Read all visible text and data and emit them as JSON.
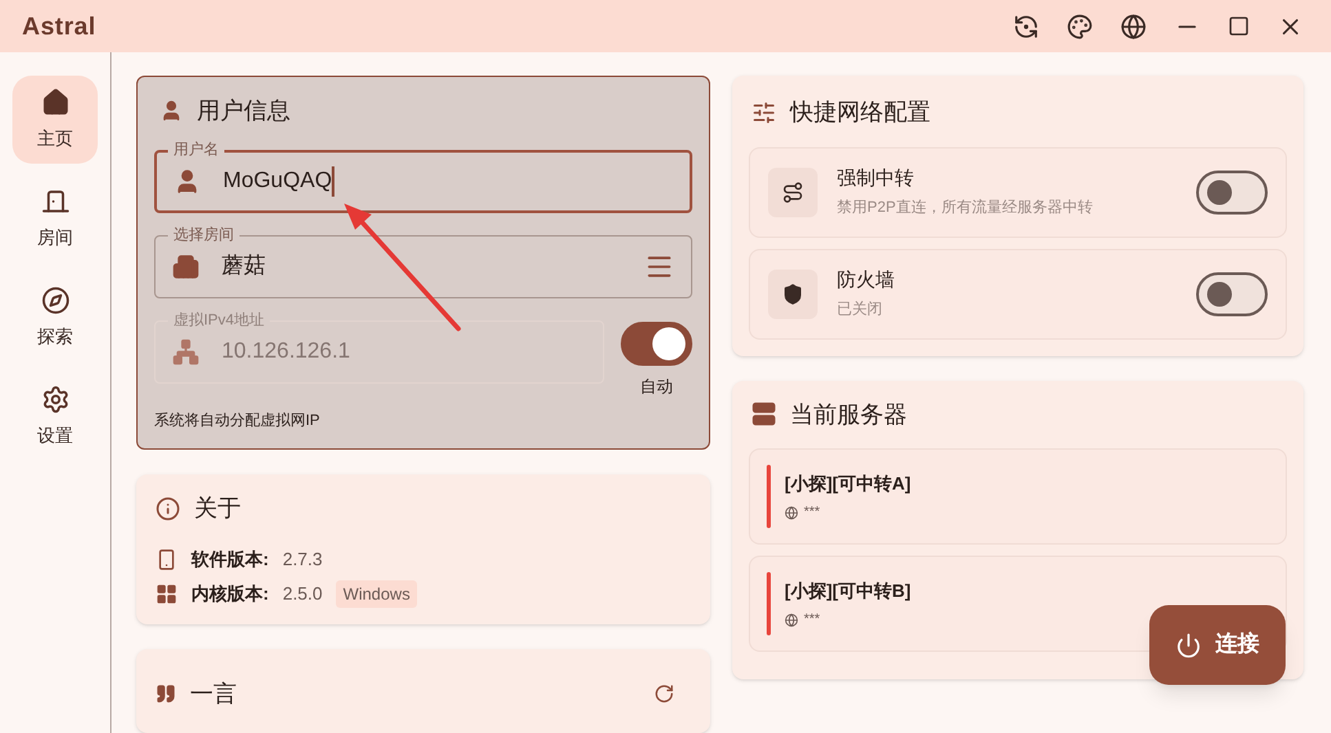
{
  "window": {
    "title": "Astral"
  },
  "sidebar": {
    "items": [
      {
        "label": "主页",
        "kind": "home",
        "selected": true
      },
      {
        "label": "房间",
        "kind": "room",
        "selected": false
      },
      {
        "label": "探索",
        "kind": "explore",
        "selected": false
      },
      {
        "label": "设置",
        "kind": "settings",
        "selected": false
      }
    ]
  },
  "user_info": {
    "title": "用户信息",
    "username": {
      "label": "用户名",
      "value": "MoGuQAQ",
      "focused": true
    },
    "room": {
      "label": "选择房间",
      "value": "蘑菇"
    },
    "ip": {
      "label": "虚拟IPv4地址",
      "value": "10.126.126.1",
      "disabled": true
    },
    "auto_toggle": {
      "label": "自动",
      "on": true
    },
    "hint": "系统将自动分配虚拟网IP"
  },
  "about": {
    "title": "关于",
    "rows": [
      {
        "kind": "app",
        "label": "软件版本:",
        "value": "2.7.3"
      },
      {
        "kind": "core",
        "label": "内核版本:",
        "value": "2.5.0",
        "badge": "Windows"
      }
    ]
  },
  "hitokoto": {
    "title": "一言"
  },
  "quick_config": {
    "title": "快捷网络配置",
    "items": [
      {
        "kind": "relay",
        "title": "强制中转",
        "subtitle": "禁用P2P直连，所有流量经服务器中转",
        "on": false
      },
      {
        "kind": "firewall",
        "title": "防火墙",
        "subtitle": "已关闭",
        "on": false
      }
    ]
  },
  "servers": {
    "title": "当前服务器",
    "items": [
      {
        "name": "[小探][可中转A]",
        "address": "***",
        "color": "#e8453c"
      },
      {
        "name": "[小探][可中转B]",
        "address": "***",
        "color": "#e8453c"
      }
    ]
  },
  "connect_button": {
    "label": "连接"
  }
}
